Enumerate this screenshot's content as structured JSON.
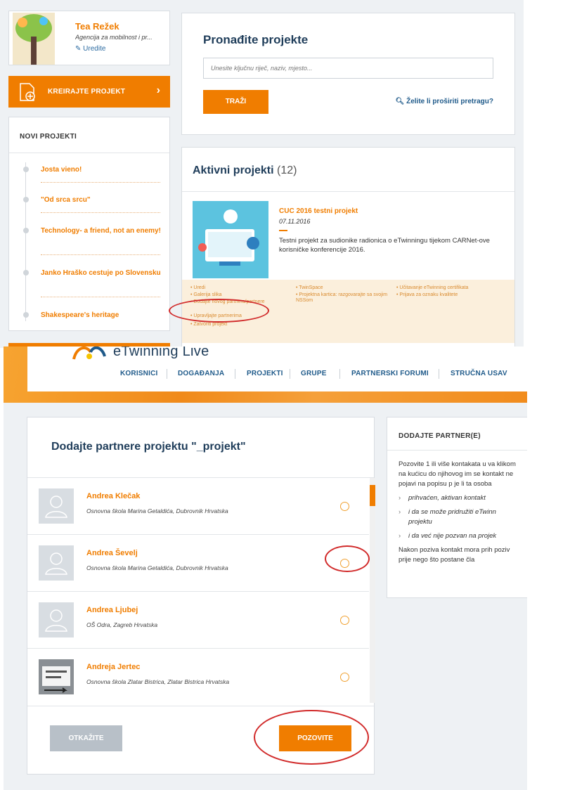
{
  "profile": {
    "name": "Tea Režek",
    "org": "Agencija za mobilnost i pr...",
    "edit_label": "Uredite"
  },
  "create_button": {
    "label": "KREIRAJTE PROJEKT",
    "chevron": "›"
  },
  "new_projects": {
    "title": "NOVI PROJEKTI",
    "items": [
      {
        "label": "Josta vieno!"
      },
      {
        "label": "\"Od srca srcu\""
      },
      {
        "label": "Technology- a friend, not an enemy!"
      },
      {
        "label": "Janko Hraško cestuje po Slovensku"
      },
      {
        "label": "Shakespeare's heritage"
      }
    ]
  },
  "search": {
    "title": "Pronađite projekte",
    "placeholder": "Unesite ključnu riječ, naziv, mjesto...",
    "button_label": "TRAŽI",
    "advanced_label": "Želite li proširiti pretragu?"
  },
  "active_projects": {
    "title": "Aktivni projekti",
    "count": "(12)",
    "project": {
      "name": "CUC 2016 testni projekt",
      "date": "07.11.2016",
      "description": "Testni projekt za sudionike radionica o eTwinningu tijekom CARNet-ove korisničke konferencije 2016."
    },
    "links": {
      "col1": [
        "• Uredi",
        "• Galerija slika",
        "• Dodajte novog partnera/partnere",
        "• Upravljajte partnerima",
        "• Zatvoriti projekt"
      ],
      "col2": [
        "• TwinSpace",
        "• Projektna kartica: razgovarajte sa svojim NSSom"
      ],
      "col3": [
        "• Učitavanje eTwinning certifikata",
        "• Prijava za oznaku kvalitete"
      ]
    }
  },
  "header": {
    "logo_text": "eTwinning Live",
    "nav": [
      "KORISNICI",
      "DOGAĐANJA",
      "PROJEKTI",
      "GRUPE",
      "PARTNERSKI FORUMI",
      "STRUČNA USAV"
    ]
  },
  "invite": {
    "title": "Dodajte partnere projektu \"_projekt\"",
    "contacts": [
      {
        "name": "Andrea Klečak",
        "school": "Osnovna škola Marina Getaldića, Dubrovnik Hrvatska"
      },
      {
        "name": "Andrea Ševelj",
        "school": "Osnovna škola Marina Getaldića, Dubrovnik Hrvatska"
      },
      {
        "name": "Andrea Ljubej",
        "school": "OŠ Odra, Zagreb Hrvatska"
      },
      {
        "name": "Andreja Jertec",
        "school": "Osnovna škola Zlatar Bistrica, Zlatar Bistrica Hrvatska"
      }
    ],
    "cancel_label": "OTKAŽITE",
    "invite_label": "POZOVITE"
  },
  "side_panel": {
    "title": "DODAJTE PARTNER(E)",
    "intro": "Pozovite 1 ili više kontakata u va klikom na kućicu do njihovog im se kontakt ne pojavi na popisu p je li ta osoba",
    "bullets": [
      "prihvaćen, aktivan kontakt",
      "i da se može pridružiti eTwinn projektu",
      "i da već nije pozvan na projek"
    ],
    "outro": "Nakon poziva kontakt mora prih poziv prije nego što postane čla"
  },
  "colors": {
    "accent": "#f07d00",
    "navy": "#1f3d5a",
    "annotation": "#d12a2a"
  }
}
